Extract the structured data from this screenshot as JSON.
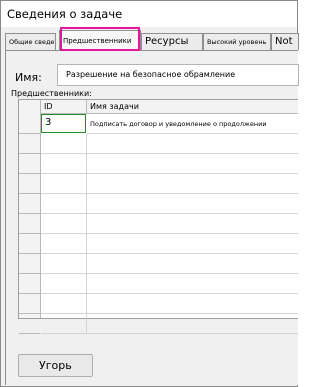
{
  "window": {
    "title": "Сведения о задаче"
  },
  "tabs": [
    {
      "label": "Общие сведения"
    },
    {
      "label": "Предшественники"
    },
    {
      "label": "Ресурсы"
    },
    {
      "label": "Высокий уровень"
    },
    {
      "label": "Not"
    }
  ],
  "form": {
    "name_label": "Имя:",
    "name_value": "Разрешение на безопасное обрамление",
    "predecessors_label": "Предшественники:"
  },
  "table": {
    "columns": [
      "ID",
      "Имя задачи"
    ],
    "rows": [
      {
        "id": "3",
        "task_name": "Подписать договор и уведомление о продолжении"
      },
      {
        "id": "",
        "task_name": ""
      },
      {
        "id": "",
        "task_name": ""
      },
      {
        "id": "",
        "task_name": ""
      },
      {
        "id": "",
        "task_name": ""
      },
      {
        "id": "",
        "task_name": ""
      },
      {
        "id": "",
        "task_name": ""
      },
      {
        "id": "",
        "task_name": ""
      },
      {
        "id": "",
        "task_name": ""
      },
      {
        "id": "",
        "task_name": ""
      },
      {
        "id": "",
        "task_name": ""
      }
    ]
  },
  "footer": {
    "button_label": "Угорь"
  },
  "colors": {
    "highlight": "#e0179a",
    "selected_cell_border": "#2b8a2b"
  }
}
